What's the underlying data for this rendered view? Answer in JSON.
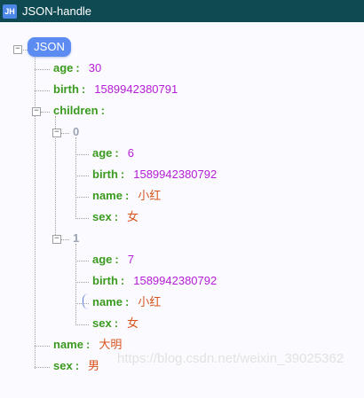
{
  "window": {
    "app_icon": "JH",
    "title": "JSON-handle"
  },
  "tree": {
    "root_label": "JSON",
    "age": {
      "key": "age",
      "value": "30"
    },
    "birth": {
      "key": "birth",
      "value": "1589942380791"
    },
    "children": {
      "key": "children",
      "items": [
        {
          "index": "0",
          "age": {
            "key": "age",
            "value": "6"
          },
          "birth": {
            "key": "birth",
            "value": "1589942380792"
          },
          "name": {
            "key": "name",
            "value": "小红"
          },
          "sex": {
            "key": "sex",
            "value": "女"
          }
        },
        {
          "index": "1",
          "age": {
            "key": "age",
            "value": "7"
          },
          "birth": {
            "key": "birth",
            "value": "1589942380792"
          },
          "name": {
            "key": "name",
            "value": "小红"
          },
          "sex": {
            "key": "sex",
            "value": "女"
          }
        }
      ]
    },
    "name": {
      "key": "name",
      "value": "大明"
    },
    "sex": {
      "key": "sex",
      "value": "男"
    }
  },
  "watermark": "https://blog.csdn.net/weixin_39025362",
  "colors": {
    "titlebar": "#0f4a52",
    "root_badge": "#5c8cf2",
    "key": "#3a9a1e",
    "number_value": "#b41dd6",
    "string_value": "#d9531f",
    "array_index": "#9aa4b4"
  }
}
